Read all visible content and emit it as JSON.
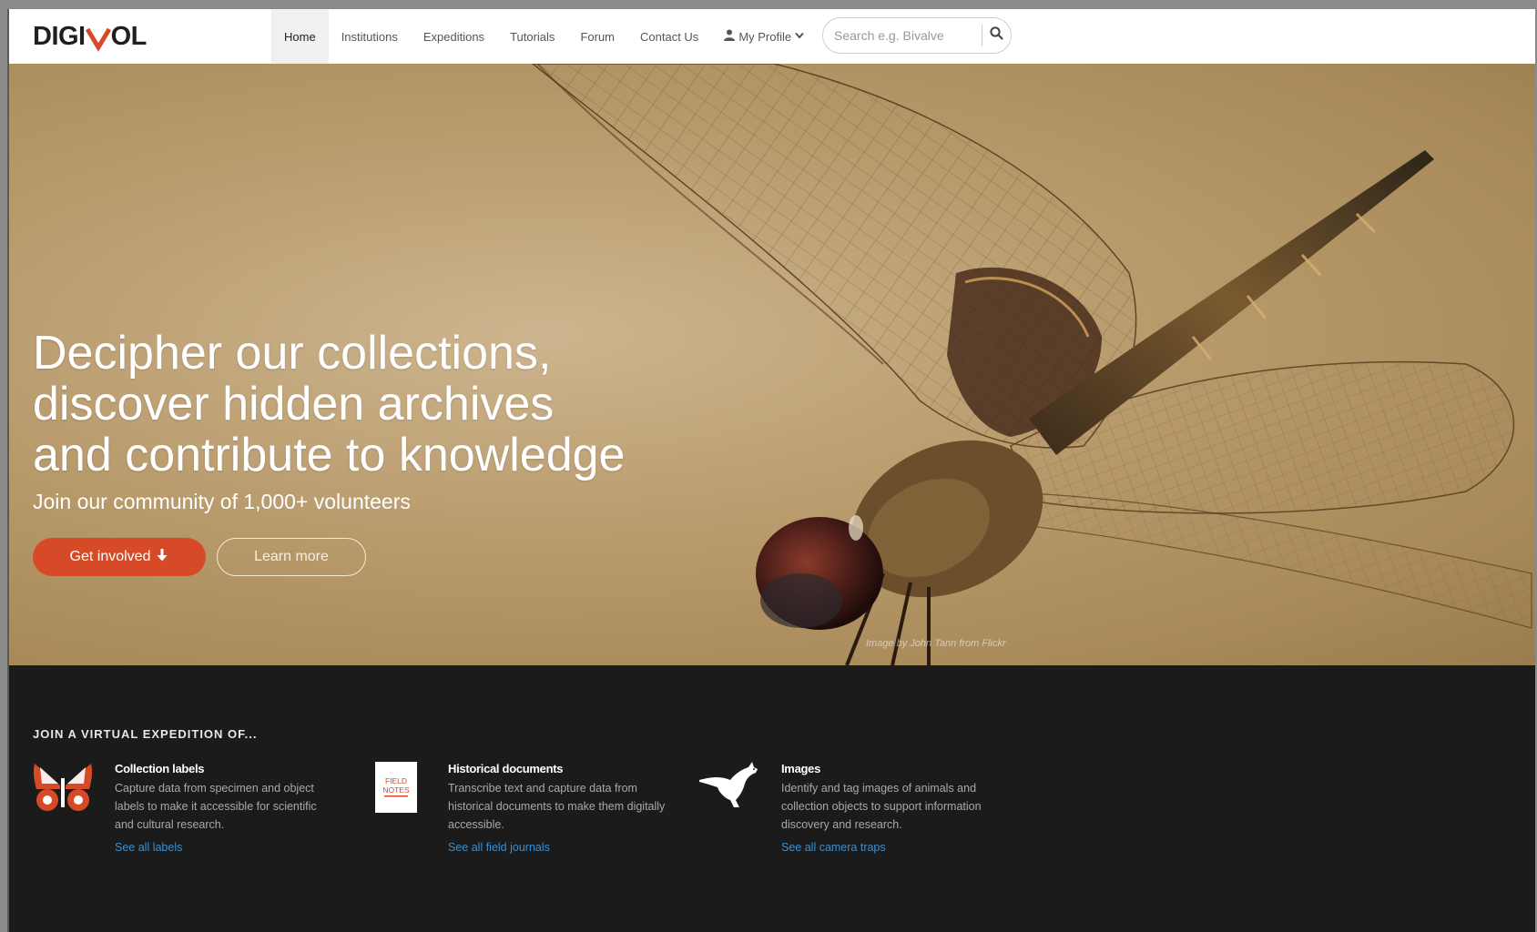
{
  "brand": {
    "logo_left": "DIGI",
    "logo_right": "OL"
  },
  "nav": {
    "items": [
      {
        "label": "Home",
        "active": true
      },
      {
        "label": "Institutions"
      },
      {
        "label": "Expeditions"
      },
      {
        "label": "Tutorials"
      },
      {
        "label": "Forum"
      },
      {
        "label": "Contact Us"
      },
      {
        "label": "My Profile",
        "icon": "person-icon",
        "dropdown": true
      }
    ],
    "search_placeholder": "Search e.g. Bivalve",
    "search_value": ""
  },
  "hero": {
    "headline_line1": "Decipher our collections,",
    "headline_line2": "discover hidden archives",
    "headline_line3": "and contribute to knowledge",
    "subhead": "Join our community of 1,000+ volunteers",
    "primary_button": "Get involved",
    "secondary_button": "Learn more",
    "image_credit": "Image by John Tann from Flickr"
  },
  "expeditions": {
    "heading": "JOIN A VIRTUAL EXPEDITION OF...",
    "cards": [
      {
        "icon": "butterfly-icon",
        "title": "Collection labels",
        "desc": "Capture data from specimen and object labels to make it accessible for scientific and cultural research.",
        "link": "See all labels"
      },
      {
        "icon": "field-notes-icon",
        "icon_text_1": "FIELD",
        "icon_text_2": "NOTES",
        "title": "Historical documents",
        "desc": "Transcribe text and capture data from historical documents to make them digitally accessible.",
        "link": "See all field journals"
      },
      {
        "icon": "kangaroo-icon",
        "title": "Images",
        "desc": "Identify and tag images of animals and collection objects to support information discovery and research.",
        "link": "See all camera traps"
      }
    ]
  },
  "colors": {
    "accent": "#d64a28",
    "link": "#3a8fd0",
    "dark_bg": "#1b1b1b",
    "logo_v": "#d64a28"
  }
}
